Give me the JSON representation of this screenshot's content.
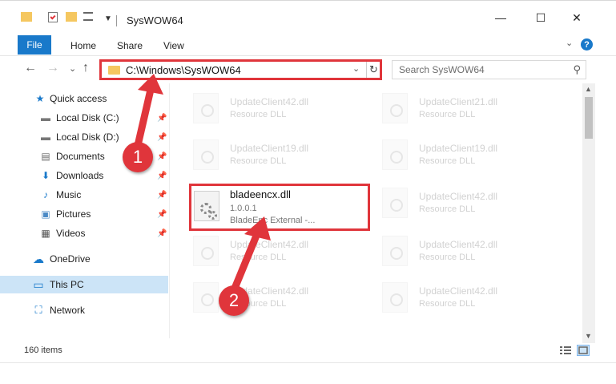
{
  "window": {
    "title": "SysWOW64",
    "minimize_glyph": "—",
    "maximize_glyph": "☐",
    "close_glyph": "✕"
  },
  "ribbon": {
    "tabs": [
      "File",
      "Home",
      "Share",
      "View"
    ],
    "collapse_glyph": "⌄",
    "help_glyph": "?"
  },
  "nav": {
    "back_glyph": "←",
    "forward_glyph": "→",
    "recent_glyph": "⌄",
    "up_glyph": "↑",
    "address": "C:\\Windows\\SysWOW64",
    "address_dropdown_glyph": "⌄",
    "refresh_glyph": "↻",
    "search_placeholder": "Search SysWOW64",
    "search_glyph": "⚲"
  },
  "sidebar": {
    "items": [
      {
        "label": "Quick access",
        "icon": "star-icon",
        "glyph": "★"
      },
      {
        "label": "Local Disk (C:)",
        "icon": "drive-icon",
        "glyph": "▬"
      },
      {
        "label": "Local Disk (D:)",
        "icon": "drive-icon",
        "glyph": "▬"
      },
      {
        "label": "Documents",
        "icon": "documents-icon",
        "glyph": "▤"
      },
      {
        "label": "Downloads",
        "icon": "download-icon",
        "glyph": "⬇"
      },
      {
        "label": "Music",
        "icon": "music-icon",
        "glyph": "♪"
      },
      {
        "label": "Pictures",
        "icon": "pictures-icon",
        "glyph": "▣"
      },
      {
        "label": "Videos",
        "icon": "videos-icon",
        "glyph": "▦"
      },
      {
        "label": "OneDrive",
        "icon": "cloud-icon",
        "glyph": "☁"
      },
      {
        "label": "This PC",
        "icon": "computer-icon",
        "glyph": "▭"
      },
      {
        "label": "Network",
        "icon": "network-icon",
        "glyph": "⛶"
      }
    ],
    "pin_glyph": "📌"
  },
  "files": [
    {
      "name": "UpdateClient42.dll",
      "desc": "Resource DLL"
    },
    {
      "name": "UpdateClient21.dll",
      "desc": "Resource DLL"
    },
    {
      "name": "UpdateClient19.dll",
      "desc": "Resource DLL"
    },
    {
      "name": "UpdateClient19.dll",
      "desc": "Resource DLL"
    },
    {
      "name": "UpdateClient42.dll",
      "desc": "Resource DLL"
    },
    {
      "name": "UpdateClient42.dll",
      "desc": "Resource DLL"
    },
    {
      "name": "UpdateClient42.dll",
      "desc": "Resource DLL"
    },
    {
      "name": "UpdateClient42.dll",
      "desc": "Resource DLL"
    },
    {
      "name": "UpdateClient42.dll",
      "desc": "Resource DLL"
    }
  ],
  "highlighted_file": {
    "name": "bladeencx.dll",
    "version": "1.0.0.1",
    "desc": "BladeEnc External -..."
  },
  "status": {
    "item_count": "160 items"
  },
  "annotations": {
    "badge1": "1",
    "badge2": "2",
    "color": "#e0353b"
  },
  "colors": {
    "accent": "#1979ca",
    "selected": "#cce4f7",
    "folder": "#f5c760"
  }
}
